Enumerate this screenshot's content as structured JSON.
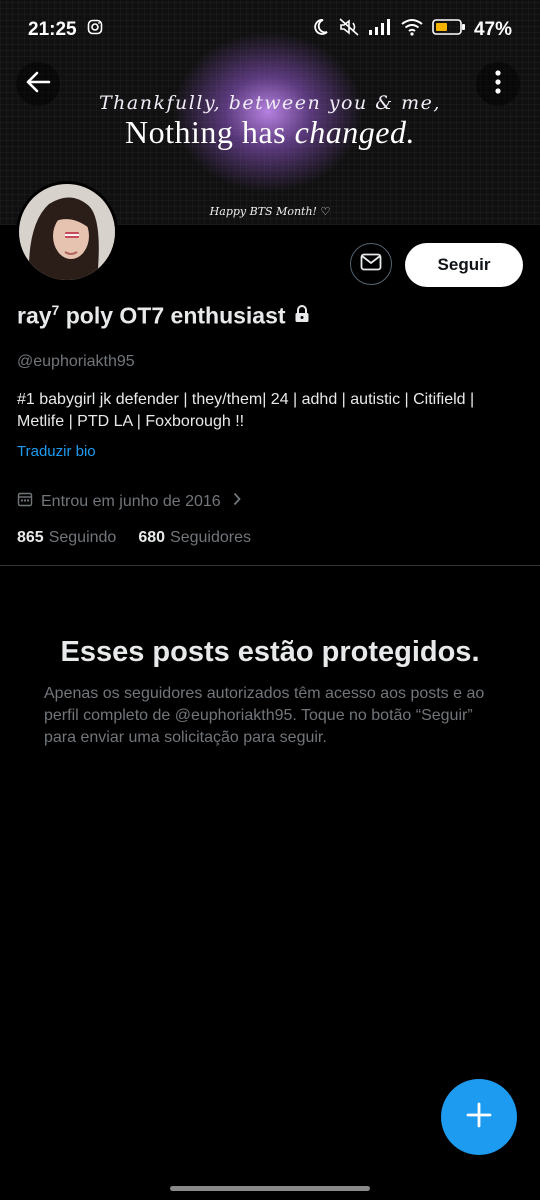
{
  "status_bar": {
    "time": "21:25",
    "battery": "47%"
  },
  "banner": {
    "line1": "Thankfully, between you & me,",
    "line2_a": "Nothing has ",
    "line2_b": "changed.",
    "line3": "Happy BTS Month! ♡",
    "accent": "#b98ae8"
  },
  "profile": {
    "name": "ray",
    "name_sup": "7",
    "name_rest": " poly OT7 enthusiast",
    "handle": "@euphoriakth95",
    "bio": "#1 babygirl jk defender | they/them| 24 | adhd | autistic | Citifield | Metlife | PTD LA | Foxborough !!",
    "translate_label": "Traduzir bio",
    "joined": "Entrou em junho de 2016",
    "following_count": "865",
    "following_label": "Seguindo",
    "followers_count": "680",
    "followers_label": "Seguidores",
    "follow_button": "Seguir"
  },
  "protected": {
    "title": "Esses posts estão protegidos.",
    "body": "Apenas os seguidores autorizados têm acesso aos posts e ao perfil completo de @euphoriakth95. Toque no botão “Seguir” para enviar uma solicitação para seguir."
  },
  "colors": {
    "accent_blue": "#1d9bf0",
    "background": "#000000",
    "muted": "#71767b"
  }
}
